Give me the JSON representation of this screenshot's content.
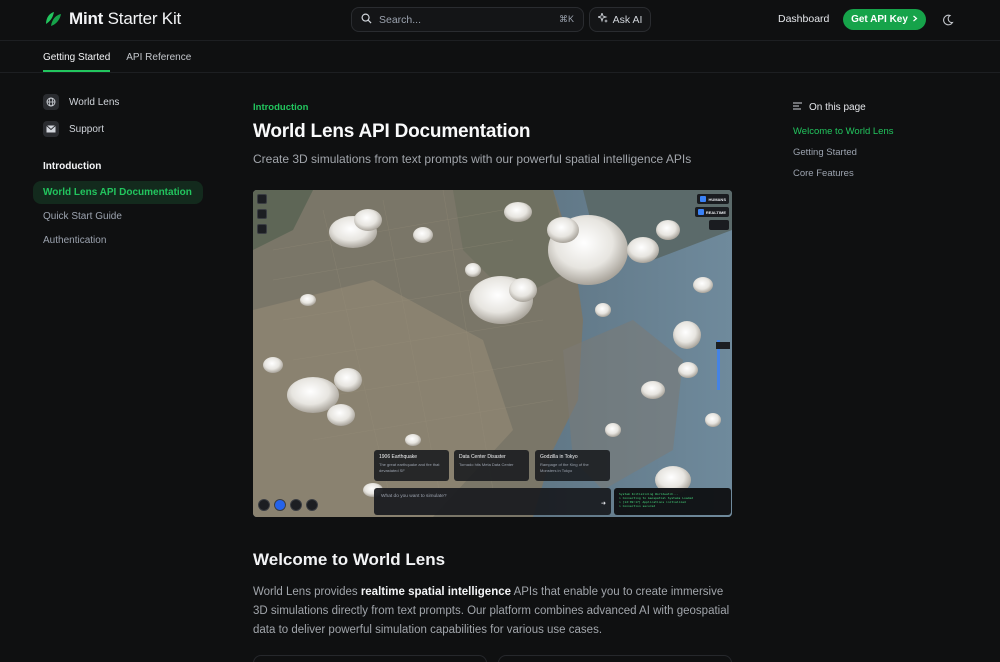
{
  "header": {
    "brand_bold": "Mint",
    "brand_rest": " Starter Kit",
    "search_placeholder": "Search...",
    "search_shortcut": "⌘K",
    "ask_ai_label": "Ask AI",
    "dashboard_label": "Dashboard",
    "api_key_label": "Get API Key",
    "accent_color": "#16a34a"
  },
  "tabs": [
    {
      "label": "Getting Started",
      "active": true
    },
    {
      "label": "API Reference",
      "active": false
    }
  ],
  "sidebar": {
    "links": [
      {
        "label": "World Lens",
        "icon": "globe-icon"
      },
      {
        "label": "Support",
        "icon": "mail-icon"
      }
    ],
    "section_heading": "Introduction",
    "items": [
      {
        "label": "World Lens API Documentation",
        "active": true
      },
      {
        "label": "Quick Start Guide",
        "active": false
      },
      {
        "label": "Authentication",
        "active": false
      }
    ]
  },
  "main": {
    "eyebrow": "Introduction",
    "title": "World Lens API Documentation",
    "subtitle": "Create 3D simulations from text prompts with our powerful spatial intelligence APIs",
    "hero": {
      "toggles": [
        "HUMANS",
        "REALTIME"
      ],
      "cards": [
        {
          "title": "1906 Earthquake",
          "desc": "The great earthquake and fire that devastated SF"
        },
        {
          "title": "Data Center Disaster",
          "desc": "Tornado hits Meta Data Center"
        },
        {
          "title": "Godzilla in Tokyo",
          "desc": "Rampage of the King of the Monsters in Tokyo"
        }
      ],
      "prompt_placeholder": "What do you want to simulate?",
      "console_lines": [
        "System Initializing Worldwatch...",
        "> Connecting to Geospatial Systems Loaded",
        "> [12:09:17] Applications initialized",
        "> Connection secured"
      ]
    },
    "section_title": "Welcome to World Lens",
    "para_1": "World Lens provides ",
    "para_bold": "realtime spatial intelligence",
    "para_2": " APIs that enable you to create immersive 3D simulations directly from text prompts. Our platform combines advanced AI with geospatial data to deliver powerful simulation capabilities for various use cases."
  },
  "toc": {
    "heading": "On this page",
    "items": [
      {
        "label": "Welcome to World Lens",
        "active": true
      },
      {
        "label": "Getting Started",
        "active": false
      },
      {
        "label": "Core Features",
        "active": false
      }
    ]
  }
}
